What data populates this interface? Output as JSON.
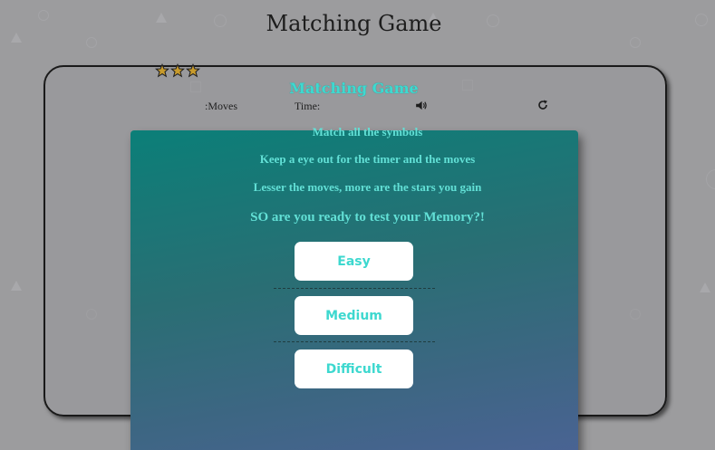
{
  "page": {
    "title": "Matching Game"
  },
  "board": {
    "title": "Matching Game",
    "stars": {
      "count": 3,
      "icon": "star-icon"
    },
    "moves_label": ":Moves",
    "time_label": "Time:",
    "sound_icon": "speaker-icon",
    "restart_icon": "restart-icon"
  },
  "modal": {
    "lines": [
      "Match all the symbols",
      "Keep a eye out for the timer and the moves",
      "Lesser the moves, more are the stars you gain",
      "SO are you ready to test your Memory?!"
    ],
    "buttons": {
      "easy": "Easy",
      "medium": "Medium",
      "difficult": "Difficult"
    }
  },
  "colors": {
    "background": "#9c9c9e",
    "accent_text": "#3dd8cf",
    "modal_top": "#0b7f78",
    "modal_bottom": "#4a6394",
    "star_fill": "#c89b2c"
  }
}
